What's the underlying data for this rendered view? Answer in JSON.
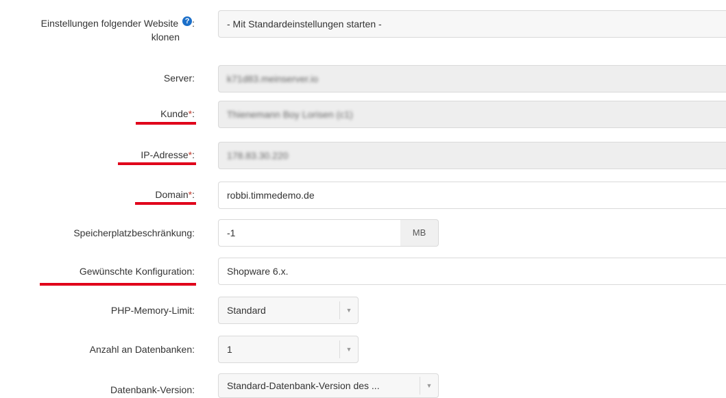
{
  "rows": {
    "clone": {
      "label_line1": "Einstellungen folgender Website",
      "label_line2": "klonen",
      "colon": ":",
      "value": "- Mit Standardeinstellungen starten -"
    },
    "server": {
      "label": "Server:",
      "value": "k71d83.meinserver.io"
    },
    "kunde": {
      "label": "Kunde",
      "required": "*",
      "colon": ":",
      "value": "Thienemann Boy Lorisen (c1)"
    },
    "ip": {
      "label": "IP-Adresse",
      "required": "*",
      "colon": ":",
      "value": "178.83.30.220"
    },
    "domain": {
      "label": "Domain",
      "required": "*",
      "colon": ":",
      "value": "robbi.timmedemo.de"
    },
    "quota": {
      "label": "Speicherplatzbeschränkung:",
      "value": "-1",
      "unit": "MB"
    },
    "config": {
      "label": "Gewünschte Konfiguration:",
      "value": "Shopware 6.x."
    },
    "php_memory": {
      "label": "PHP-Memory-Limit:",
      "value": "Standard"
    },
    "db_count": {
      "label": "Anzahl an Datenbanken:",
      "value": "1"
    },
    "db_version": {
      "label": "Datenbank-Version:",
      "value": "Standard-Datenbank-Version des ..."
    }
  },
  "icons": {
    "help": "question-circle-icon",
    "dropdown": "chevron-down-icon"
  },
  "colors": {
    "required_marker": "#c0392b",
    "highlight_underline": "#e0001a",
    "help_icon": "#1b6fc9"
  }
}
